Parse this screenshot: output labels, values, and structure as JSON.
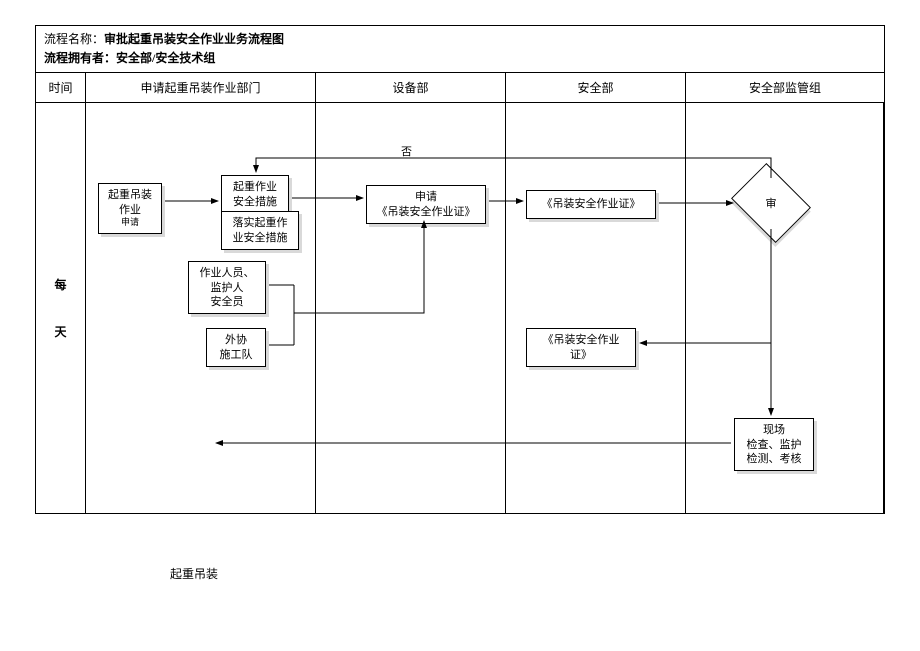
{
  "header": {
    "label_process_name": "流程名称：",
    "process_name": "审批起重吊装安全作业业务流程图",
    "label_owner": "流程拥有者：",
    "owner": "安全部/安全技术组"
  },
  "columns": {
    "time": "时间",
    "apply_dept": "申请起重吊装作业部门",
    "equip_dept": "设备部",
    "safety_dept": "安全部",
    "supervise_group": "安全部监管组"
  },
  "time_lane": {
    "line1": "每",
    "line2": "天"
  },
  "boxes": {
    "b1_l1": "起重吊装",
    "b1_l2": "作业",
    "b1_l3": "申请",
    "b2_l1": "起重作业",
    "b2_l2": "安全措施",
    "b3_l1": "落实起重作",
    "b3_l2": "业安全措施",
    "b4_l1": "作业人员、",
    "b4_l2": "监护人",
    "b4_l3": "安全员",
    "b5_l1": "外协",
    "b5_l2": "施工队",
    "b6_l1": "申请",
    "b6_l2": "《吊装安全作业证》",
    "b7": "《吊装安全作业证》",
    "b8_l1": "《吊装安全作业",
    "b8_l2": "证》",
    "b9_l1": "现场",
    "b9_l2": "检查、监护",
    "b9_l3": "检测、考核"
  },
  "decision": {
    "d1": "审"
  },
  "labels": {
    "no": "否"
  },
  "footer": {
    "text": "起重吊装"
  }
}
